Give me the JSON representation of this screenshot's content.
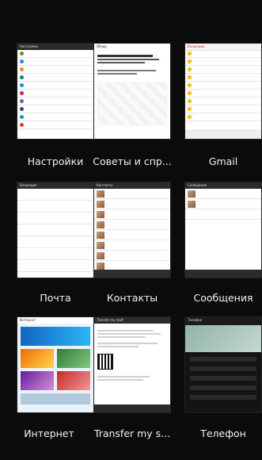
{
  "apps": [
    {
      "id": "settings",
      "label": "Настройки",
      "bar_title": "Настройки"
    },
    {
      "id": "tips",
      "label": "Советы и спр...",
      "bar_title": "Обзор"
    },
    {
      "id": "gmail",
      "label": "Gmail",
      "bar_title": "Входящие"
    },
    {
      "id": "mail",
      "label": "Почта",
      "bar_title": "Входящие"
    },
    {
      "id": "contacts",
      "label": "Контакты",
      "bar_title": "Контакты"
    },
    {
      "id": "messages",
      "label": "Сообщения",
      "bar_title": "Сообщения"
    },
    {
      "id": "internet",
      "label": "Интернет",
      "bar_title": "Интернет"
    },
    {
      "id": "transfer",
      "label": "Transfer my s...",
      "bar_title": "Transfer my stuff"
    },
    {
      "id": "phone",
      "label": "Телефон",
      "bar_title": "Телефон"
    }
  ],
  "colors": {
    "background": "#0b0b0b",
    "label": "#f2f2f2",
    "settings_icon_a": "#6b8e23",
    "settings_icon_b": "#1e88e5",
    "settings_icon_c": "#d81b60",
    "gmail_red": "#d93025",
    "contacts_green": "#2e7d32",
    "internet_blue": "#1565c0",
    "phone_dark": "#1b1b1b"
  }
}
